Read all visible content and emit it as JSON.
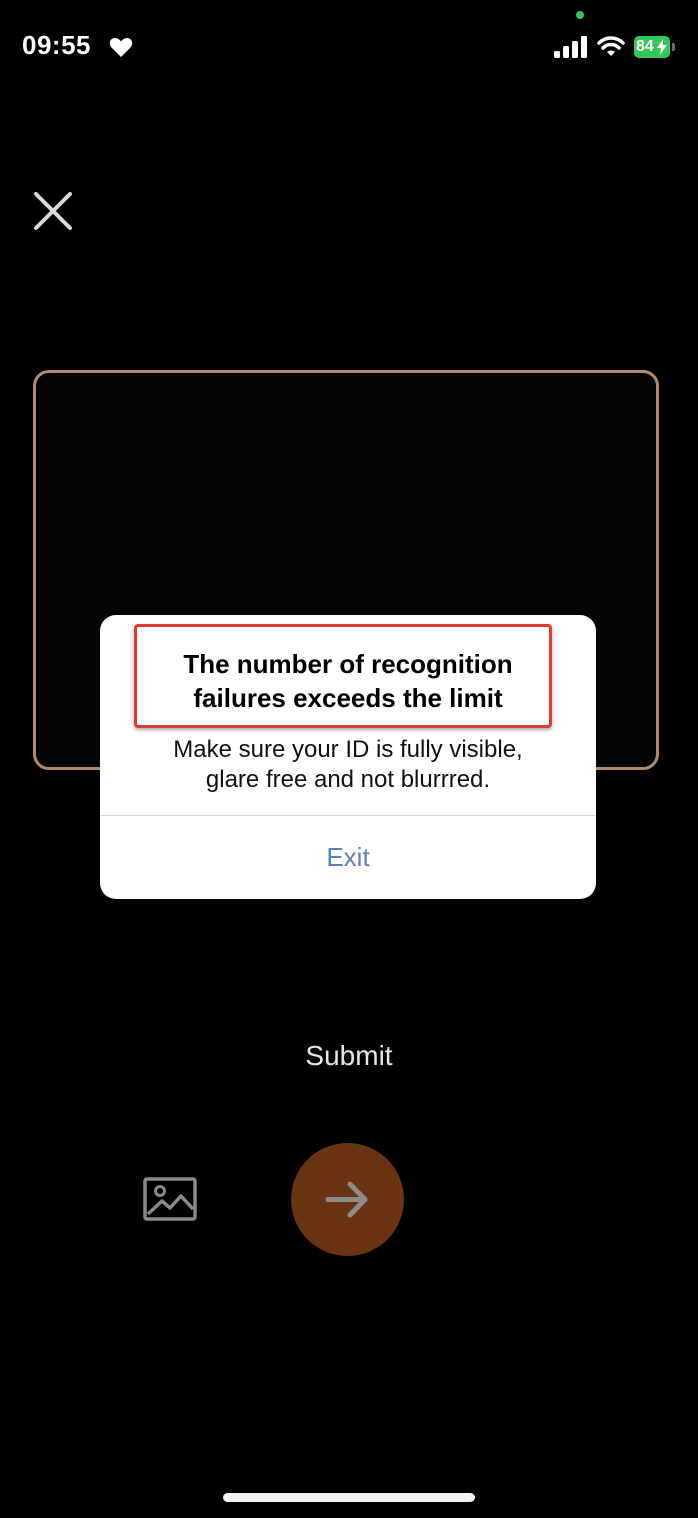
{
  "status_bar": {
    "time": "09:55",
    "battery": "84",
    "icons": [
      "heart-icon",
      "camera-in-use-dot",
      "cellular-signal-icon",
      "wifi-icon",
      "battery-charging-icon"
    ]
  },
  "close_icon": "close-icon",
  "dialog": {
    "title_line1": "The number of recognition",
    "title_line2": "failures exceeds the limit",
    "message_line1": "Make sure your ID is fully visible,",
    "message_line2": "glare free and not blurrred.",
    "exit_label": "Exit",
    "colors": {
      "exit": "#5b7fbf",
      "highlight": "#e23a2e"
    }
  },
  "bottom": {
    "submit_label": "Submit",
    "gallery_icon": "gallery-image-icon",
    "next_icon": "arrow-right-icon",
    "colors": {
      "next_button": "#6a3312",
      "frame": "#b08a6a"
    }
  }
}
